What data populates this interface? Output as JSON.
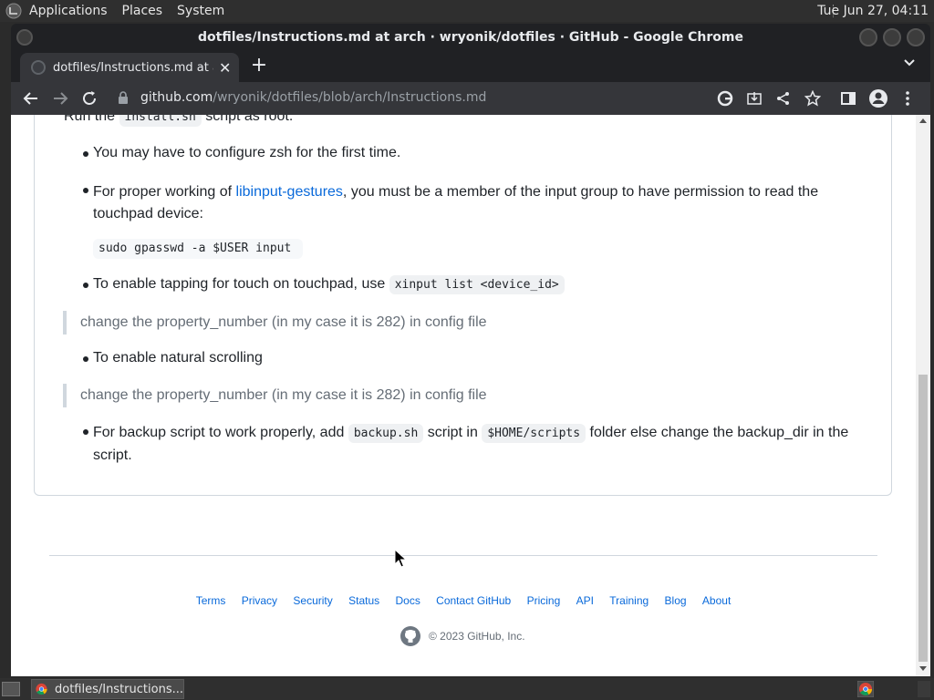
{
  "panel": {
    "menus": [
      "Applications",
      "Places",
      "System"
    ],
    "clock": "Tue Jun 27, 04:11"
  },
  "window": {
    "title": "dotfiles/Instructions.md at arch · wryonik/dotfiles · GitHub - Google Chrome"
  },
  "tabs": [
    {
      "label": "dotfiles/Instructions.md at arch"
    }
  ],
  "omnibox": {
    "host": "github.com",
    "path": "/wryonik/dotfiles/blob/arch/Instructions.md"
  },
  "readme": {
    "run_prefix": "Run the",
    "run_code": "install.sh",
    "run_suffix": "script as root.",
    "item1": "You may have to configure zsh for the first time.",
    "item2_pre": "For proper working of",
    "item2_link": "libinput-gestures",
    "item2_post": ", you must be a member of the input group to have permission to read the",
    "item2_line2": "touchpad device:",
    "code_block": "sudo gpasswd -a $USER input",
    "item3_text": "To enable tapping for touch on touchpad, use",
    "item3_code": "xinput list <device_id>",
    "quote1": "change the property_number (in my case it is 282) in config file",
    "item4": "To enable natural scrolling",
    "quote2": "change the property_number (in my case it is 282) in config file",
    "item5_pre": "For backup script to work properly, add",
    "item5_code1": "backup.sh",
    "item5_mid": "script in",
    "item5_code2": "$HOME/scripts",
    "item5_post": "folder else change the backup_dir in the",
    "item5_line2": "script."
  },
  "footer": {
    "links": [
      "Terms",
      "Privacy",
      "Security",
      "Status",
      "Docs",
      "Contact GitHub",
      "Pricing",
      "API",
      "Training",
      "Blog",
      "About"
    ],
    "copyright": "© 2023 GitHub, Inc."
  },
  "taskbar": {
    "task_label": "dotfiles/Instructions..."
  }
}
